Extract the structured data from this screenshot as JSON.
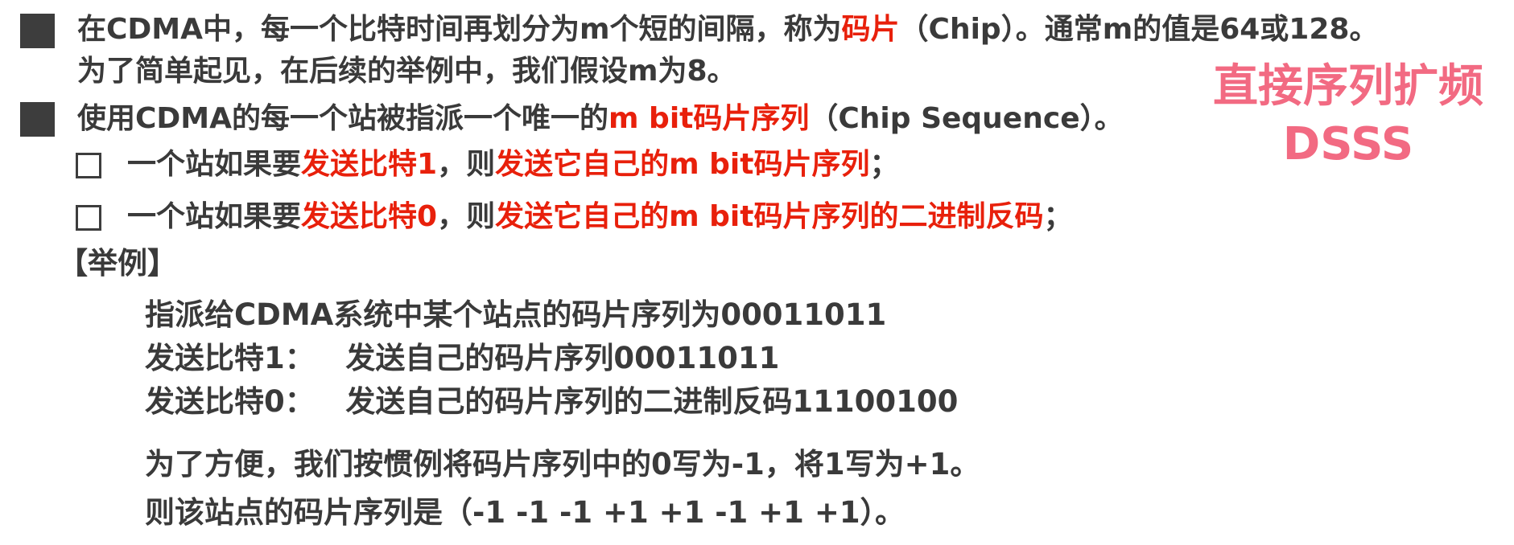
{
  "bullets": {
    "b1_line1_pre": "在CDMA中，每一个比特时间再划分为m个短的间隔，称为",
    "b1_line1_red": "码片",
    "b1_line1_post": "（Chip）。通常m的值是64或128。",
    "b1_line2": "为了简单起见，在后续的举例中，我们假设m为8。",
    "b2_pre": "使用CDMA的每一个站被指派一个唯一的",
    "b2_red": "m bit码片序列",
    "b2_post": "（Chip Sequence）。"
  },
  "sub_bullets": [
    {
      "t1": "一个站如果要",
      "t2_red": "发送比特1",
      "t3": "，则",
      "t4_red": "发送它自己的m bit码片序列",
      "t5": "；"
    },
    {
      "t1": "一个站如果要",
      "t2_red": "发送比特0",
      "t3": "，则",
      "t4_red": "发送它自己的m bit码片序列的二进制反码",
      "t5": "；"
    }
  ],
  "example": {
    "header": "【举例】",
    "lines": [
      "指派给CDMA系统中某个站点的码片序列为00011011",
      "发送比特1：   发送自己的码片序列00011011",
      "发送比特0：   发送自己的码片序列的二进制反码11100100",
      "为了方便，我们按惯例将码片序列中的0写为-1，将1写为+1。",
      "则该站点的码片序列是（-1 -1 -1 +1 +1 -1 +1 +1）。"
    ]
  },
  "watermark": {
    "line1": "直接序列扩频",
    "line2": "DSSS"
  },
  "colors": {
    "text": "#3a3a3a",
    "accent_red": "#e8200b",
    "watermark_pink": "#f26a82",
    "bullet": "#3d3d3d"
  }
}
